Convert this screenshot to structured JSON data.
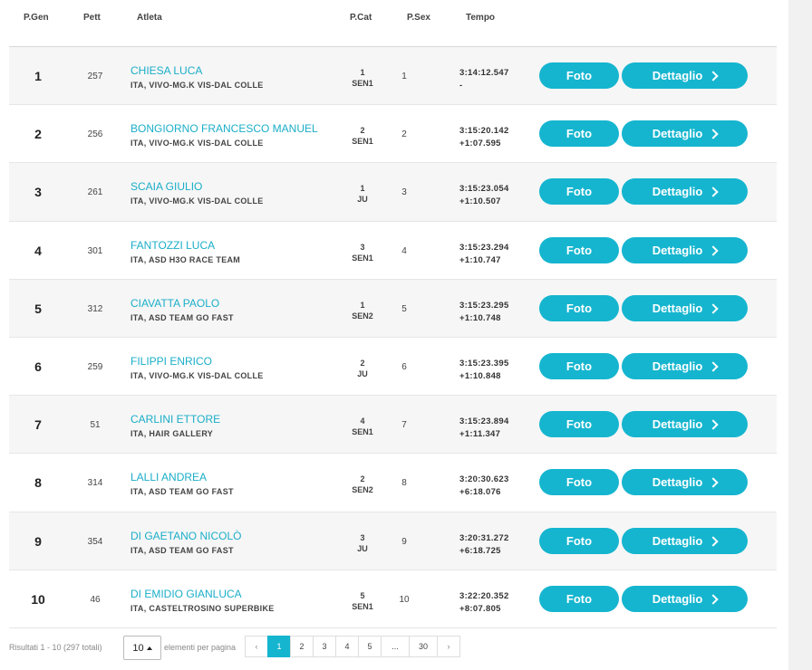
{
  "headers": {
    "pgen": "P.Gen",
    "pett": "Pett",
    "atleta": "Atleta",
    "pcat": "P.Cat",
    "psex": "P.Sex",
    "tempo": "Tempo"
  },
  "buttons": {
    "foto": "Foto",
    "dettaglio": "Dettaglio"
  },
  "rows": [
    {
      "pgen": "1",
      "pett": "257",
      "name": "CHIESA LUCA",
      "team": "ITA, VIVO-MG.K VIS-DAL COLLE",
      "pcat": "1",
      "cat": "SEN1",
      "psex": "1",
      "time": "3:14:12.547",
      "gap": "-"
    },
    {
      "pgen": "2",
      "pett": "256",
      "name": "BONGIORNO FRANCESCO MANUEL",
      "team": "ITA, VIVO-MG.K VIS-DAL COLLE",
      "pcat": "2",
      "cat": "SEN1",
      "psex": "2",
      "time": "3:15:20.142",
      "gap": "+1:07.595"
    },
    {
      "pgen": "3",
      "pett": "261",
      "name": "SCAIA GIULIO",
      "team": "ITA, VIVO-MG.K VIS-DAL COLLE",
      "pcat": "1",
      "cat": "JU",
      "psex": "3",
      "time": "3:15:23.054",
      "gap": "+1:10.507"
    },
    {
      "pgen": "4",
      "pett": "301",
      "name": "FANTOZZI LUCA",
      "team": "ITA, ASD H3O RACE TEAM",
      "pcat": "3",
      "cat": "SEN1",
      "psex": "4",
      "time": "3:15:23.294",
      "gap": "+1:10.747"
    },
    {
      "pgen": "5",
      "pett": "312",
      "name": "CIAVATTA PAOLO",
      "team": "ITA, ASD TEAM GO FAST",
      "pcat": "1",
      "cat": "SEN2",
      "psex": "5",
      "time": "3:15:23.295",
      "gap": "+1:10.748"
    },
    {
      "pgen": "6",
      "pett": "259",
      "name": "FILIPPI ENRICO",
      "team": "ITA, VIVO-MG.K VIS-DAL COLLE",
      "pcat": "2",
      "cat": "JU",
      "psex": "6",
      "time": "3:15:23.395",
      "gap": "+1:10.848"
    },
    {
      "pgen": "7",
      "pett": "51",
      "name": "CARLINI ETTORE",
      "team": "ITA, HAIR GALLERY",
      "pcat": "4",
      "cat": "SEN1",
      "psex": "7",
      "time": "3:15:23.894",
      "gap": "+1:11.347"
    },
    {
      "pgen": "8",
      "pett": "314",
      "name": "LALLI ANDREA",
      "team": "ITA, ASD TEAM GO FAST",
      "pcat": "2",
      "cat": "SEN2",
      "psex": "8",
      "time": "3:20:30.623",
      "gap": "+6:18.076"
    },
    {
      "pgen": "9",
      "pett": "354",
      "name": "DI GAETANO NICOLÒ",
      "team": "ITA, ASD TEAM GO FAST",
      "pcat": "3",
      "cat": "JU",
      "psex": "9",
      "time": "3:20:31.272",
      "gap": "+6:18.725"
    },
    {
      "pgen": "10",
      "pett": "46",
      "name": "DI EMIDIO GIANLUCA",
      "team": "ITA, CASTELTROSINO SUPERBIKE",
      "pcat": "5",
      "cat": "SEN1",
      "psex": "10",
      "time": "3:22:20.352",
      "gap": "+8:07.805"
    }
  ],
  "footer": {
    "results_text": "Risultati 1 - 10 (297 totali)",
    "per_page_value": "10",
    "per_page_label": "elementi per pagina",
    "pager": {
      "prev": "‹",
      "pages": [
        "1",
        "2",
        "3",
        "4",
        "5",
        "...",
        "30"
      ],
      "active": "1",
      "next": "›"
    }
  },
  "colors": {
    "accent": "#15b5cf",
    "name_link": "#1aaec8",
    "row_alt": "#f6f6f6"
  }
}
